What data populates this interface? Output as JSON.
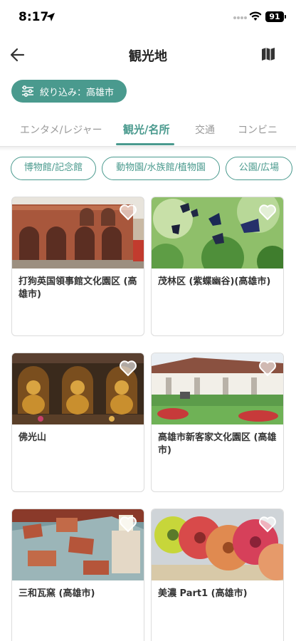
{
  "status": {
    "time": "8:17",
    "battery": "91"
  },
  "header": {
    "title": "観光地"
  },
  "filter": {
    "label": "絞り込み：高雄市"
  },
  "tabs": [
    {
      "label": "エンタメ/レジャー",
      "active": false
    },
    {
      "label": "観光/名所",
      "active": true
    },
    {
      "label": "交通",
      "active": false
    },
    {
      "label": "コンビニ",
      "active": false
    }
  ],
  "chips": [
    {
      "label": "博物館/記念館"
    },
    {
      "label": "動物園/水族館/植物園"
    },
    {
      "label": "公園/広場"
    }
  ],
  "cards": [
    {
      "title": "打狗英国領事館文化園区 (高雄市)"
    },
    {
      "title": "茂林区 (紫蝶幽谷)(高雄市)"
    },
    {
      "title": "佛光山"
    },
    {
      "title": "高雄市新客家文化園区 (高雄市)"
    },
    {
      "title": "三和瓦窯 (高雄市)"
    },
    {
      "title": "美濃 Part1 (高雄市)"
    }
  ],
  "colors": {
    "accent": "#4a9a8e"
  }
}
